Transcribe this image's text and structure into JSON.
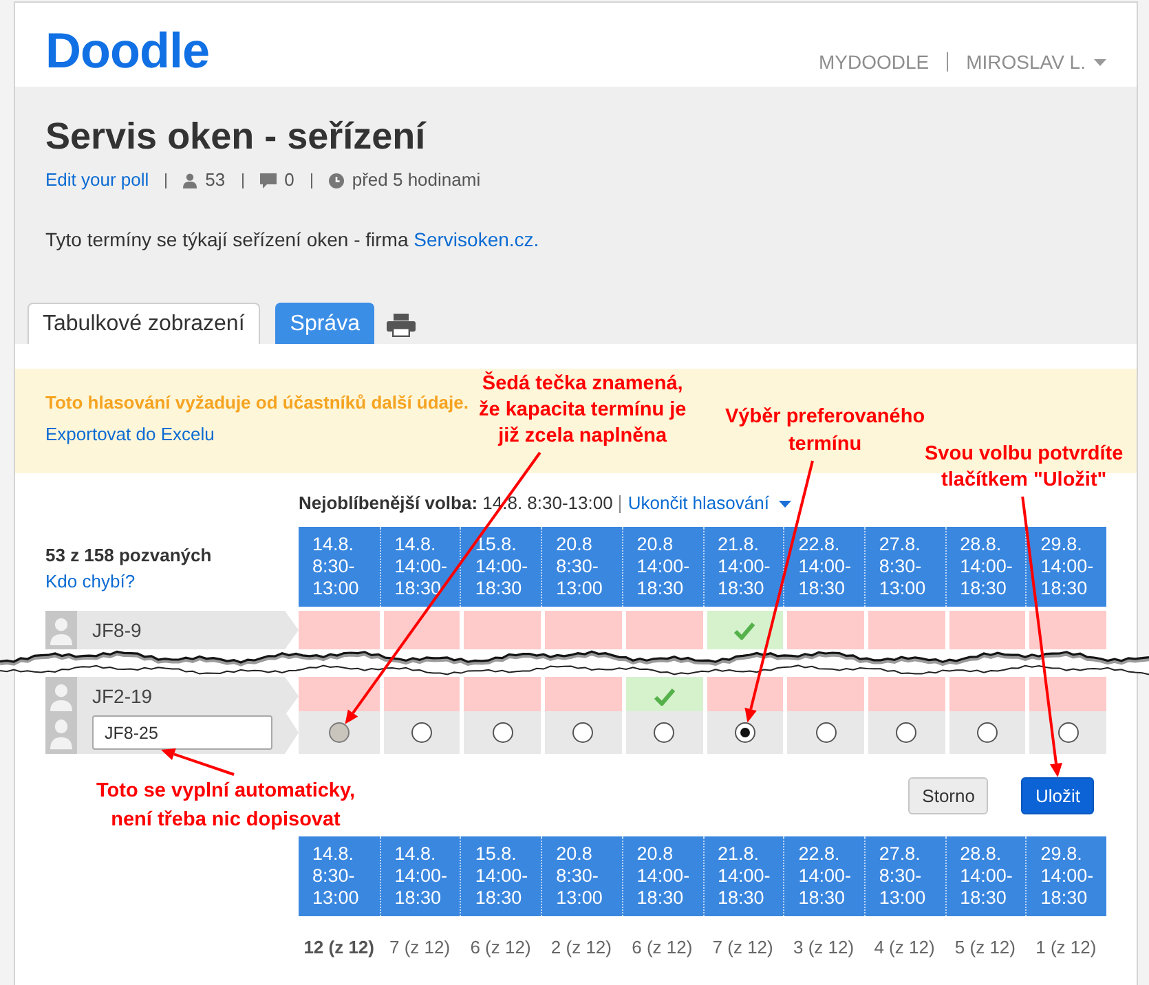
{
  "header": {
    "logo": "Doodle",
    "nav": [
      {
        "label": "MYDOODLE",
        "kind": "link"
      },
      {
        "label": "MIROSLAV L.",
        "kind": "dropdown"
      }
    ]
  },
  "poll": {
    "title": "Servis oken - seřízení",
    "edit_link": "Edit your poll",
    "participants": "53",
    "comments": "0",
    "created": "před 5 hodinami",
    "description": {
      "text": "Tyto termíny se týkají seřízení oken - firma",
      "link": "Servisoken.cz."
    }
  },
  "tabs": [
    {
      "label": "Tabulkové zobrazení",
      "selected": true
    },
    {
      "label": "Správa",
      "selected": false
    }
  ],
  "notice": {
    "text": "Toto hlasování vyžaduje od účastníků další údaje.",
    "export_link": "Exportovat do Excelu"
  },
  "summary": {
    "text": "**Nejoblíbenější volba:** 14.8. 8:30-13:00",
    "end_link": "Ukončit hlasování"
  },
  "invited": {
    "count": "53 z 158 pozvaných",
    "missing_link": "Kdo chybí?"
  },
  "table": {
    "columns": [
      {
        "date": "14.8.",
        "time": "8:30-13:00"
      },
      {
        "date": "14.8.",
        "time": "14:00-18:30"
      },
      {
        "date": "15.8.",
        "time": "14:00-18:30"
      },
      {
        "date": "20.8",
        "time": "8:30-13:00"
      },
      {
        "date": "20.8",
        "time": "14:00-18:30"
      },
      {
        "date": "21.8.",
        "time": "14:00-18:30"
      },
      {
        "date": "22.8.",
        "time": "14:00-18:30"
      },
      {
        "date": "27.8.",
        "time": "8:30-13:00"
      },
      {
        "date": "28.8.",
        "time": "14:00-18:30"
      },
      {
        "date": "29.8.",
        "time": "14:00-18:30"
      }
    ],
    "participants": [
      {
        "name": "JF8-9",
        "votes": [
          {
            "yes": false
          },
          {
            "yes": false
          },
          {
            "yes": false
          },
          {
            "yes": false
          },
          {
            "yes": false
          },
          {
            "yes": true
          },
          {
            "yes": false
          },
          {
            "yes": false
          },
          {
            "yes": false
          },
          {
            "yes": false
          }
        ]
      },
      {
        "name": "JF2-19",
        "votes": [
          {
            "yes": false
          },
          {
            "yes": false
          },
          {
            "yes": false
          },
          {
            "yes": false
          },
          {
            "yes": true
          },
          {
            "yes": false
          },
          {
            "yes": false
          },
          {
            "yes": false
          },
          {
            "yes": false
          },
          {
            "yes": false
          }
        ]
      }
    ],
    "entry": {
      "name": "JF8-25",
      "options": [
        {
          "selected": false,
          "disabled": true
        },
        {
          "selected": false,
          "disabled": false
        },
        {
          "selected": false,
          "disabled": false
        },
        {
          "selected": false,
          "disabled": false
        },
        {
          "selected": false,
          "disabled": false
        },
        {
          "selected": true,
          "disabled": false
        },
        {
          "selected": false,
          "disabled": false
        },
        {
          "selected": false,
          "disabled": false
        },
        {
          "selected": false,
          "disabled": false
        },
        {
          "selected": false,
          "disabled": false
        }
      ]
    },
    "footer_columns": [
      {
        "date": "14.8.",
        "time": "8:30-13:00"
      },
      {
        "date": "14.8.",
        "time": "14:00-18:30"
      },
      {
        "date": "15.8.",
        "time": "14:00-18:30"
      },
      {
        "date": "20.8",
        "time": "8:30-13:00"
      },
      {
        "date": "20.8",
        "time": "14:00-18:30"
      },
      {
        "date": "21.8.",
        "time": "14:00-18:30"
      },
      {
        "date": "22.8.",
        "time": "14:00-18:30"
      },
      {
        "date": "27.8.",
        "time": "8:30-13:00"
      },
      {
        "date": "28.8.",
        "time": "14:00-18:30"
      },
      {
        "date": "29.8.",
        "time": "14:00-18:30"
      }
    ],
    "totals": [
      {
        "text": "12 (z 12)",
        "top": true
      },
      {
        "text": "7 (z 12)",
        "top": false
      },
      {
        "text": "6 (z 12)",
        "top": false
      },
      {
        "text": "2 (z 12)",
        "top": false
      },
      {
        "text": "6 (z 12)",
        "top": false
      },
      {
        "text": "7 (z 12)",
        "top": false
      },
      {
        "text": "3 (z 12)",
        "top": false
      },
      {
        "text": "4 (z 12)",
        "top": false
      },
      {
        "text": "5 (z 12)",
        "top": false
      },
      {
        "text": "1 (z 12)",
        "top": false
      }
    ]
  },
  "buttons": [
    {
      "label": "Storno",
      "kind": "secondary"
    },
    {
      "label": "Uložit",
      "kind": "primary"
    }
  ],
  "annotations": [
    {
      "lines": [
        "Šedá tečka znamená,",
        "že kapacita termínu je",
        "již zcela naplněna"
      ]
    },
    {
      "lines": [
        "Výběr preferovaného",
        "termínu"
      ]
    },
    {
      "lines": [
        "Svou volbu potvrdíte",
        "tlačítkem \"Uložit\""
      ]
    },
    {
      "lines": [
        "Toto se vyplní automaticky,",
        "není třeba nic dopisovat"
      ]
    }
  ]
}
